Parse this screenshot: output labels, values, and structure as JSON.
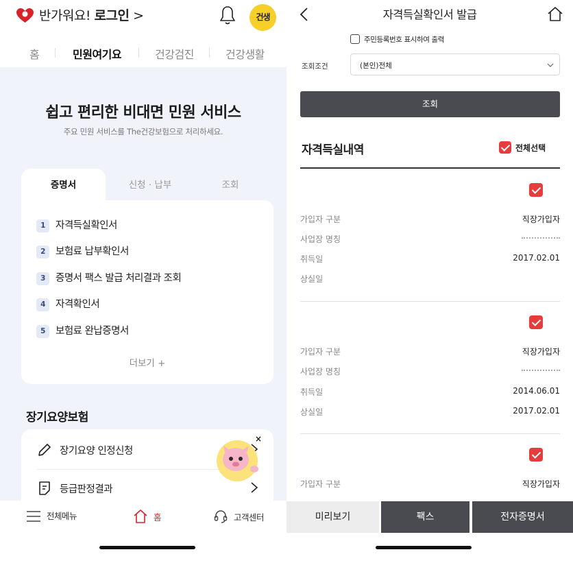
{
  "left": {
    "greeting_prefix": "반가워요!",
    "greeting_login": "로그인",
    "greeting_arrow": ">",
    "profile_badge": "건생",
    "tabs": [
      "홈",
      "민원여기요",
      "건강검진",
      "건강생활"
    ],
    "hero_title": "쉽고 편리한 비대면 민원 서비스",
    "hero_subtitle": "주요 민원 서비스를 The건강보험으로 처리하세요.",
    "card_tabs": [
      "증명서",
      "신청 · 납부",
      "조회"
    ],
    "documents": [
      {
        "num": "1",
        "label": "자격득실확인서"
      },
      {
        "num": "2",
        "label": "보험료 납부확인서"
      },
      {
        "num": "3",
        "label": "증명서 팩스 발급 처리결과 조회"
      },
      {
        "num": "4",
        "label": "자격확인서"
      },
      {
        "num": "5",
        "label": "보험료 완납증명서"
      }
    ],
    "more_label": "더보기 +",
    "ltc_title": "장기요양보험",
    "ltc_items": [
      "장기요양 인정신청",
      "등급판정결과"
    ],
    "ltc_close": "×",
    "bottom_nav": [
      "전체메뉴",
      "홈",
      "고객센터"
    ]
  },
  "right": {
    "title": "자격득실확인서 발급",
    "print_option": "주민등록번호 표시하여 출력",
    "cond_label": "조회조건",
    "cond_value": "(본인)전체",
    "search_button": "조회",
    "section_title": "자격득실내역",
    "select_all": "전체선택",
    "records": [
      {
        "rows": [
          {
            "k": "가입자 구분",
            "v": "직장가입자"
          },
          {
            "k": "사업장 명칭",
            "v": ""
          },
          {
            "k": "취득일",
            "v": "2017.02.01"
          },
          {
            "k": "상실일",
            "v": ""
          }
        ]
      },
      {
        "rows": [
          {
            "k": "가입자 구분",
            "v": "직장가입자"
          },
          {
            "k": "사업장 명칭",
            "v": ""
          },
          {
            "k": "취득일",
            "v": "2014.06.01"
          },
          {
            "k": "상실일",
            "v": "2017.02.01"
          }
        ]
      },
      {
        "rows": [
          {
            "k": "가입자 구분",
            "v": "직장가입자"
          }
        ]
      }
    ],
    "bottom_buttons": [
      "미리보기",
      "팩스",
      "전자증명서"
    ]
  },
  "colors": {
    "accent_red": "#e63c3c",
    "badge_yellow": "#f6cf2a",
    "dark_button": "#4a4a51",
    "hero_bg": "#f0f3fa"
  },
  "icons": [
    "heart-logo-icon",
    "bell-icon",
    "pencil-icon",
    "document-icon",
    "chevron-right-icon",
    "hamburger-menu-icon",
    "home-icon",
    "headset-icon",
    "back-arrow-icon",
    "chevron-down-icon",
    "checkbox-icon"
  ]
}
